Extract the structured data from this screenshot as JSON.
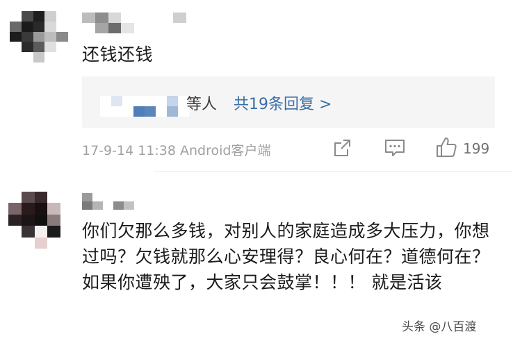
{
  "comment1": {
    "text": "还钱还钱",
    "reply_suffix": "等人",
    "reply_more": "共19条回复 >",
    "timestamp": "17-9-14 11:38",
    "client": "Android客户端",
    "like_count": "199"
  },
  "comment2": {
    "text": "你们欠那么多钱，对别人的家庭造成多大压力，你想过吗？欠钱就那么心安理得？良心何在？道德何在？ 如果你遭殃了，大家只会鼓掌！！！ 就是活该"
  },
  "watermark": "头条 @八百渡",
  "colors": {
    "text": "#1b1b1b",
    "meta": "#a0a0a0",
    "link": "#3a6ea5",
    "reply_bg": "#f5f5f5"
  },
  "icons": [
    "share-icon",
    "comment-icon",
    "thumbs-up-icon"
  ]
}
